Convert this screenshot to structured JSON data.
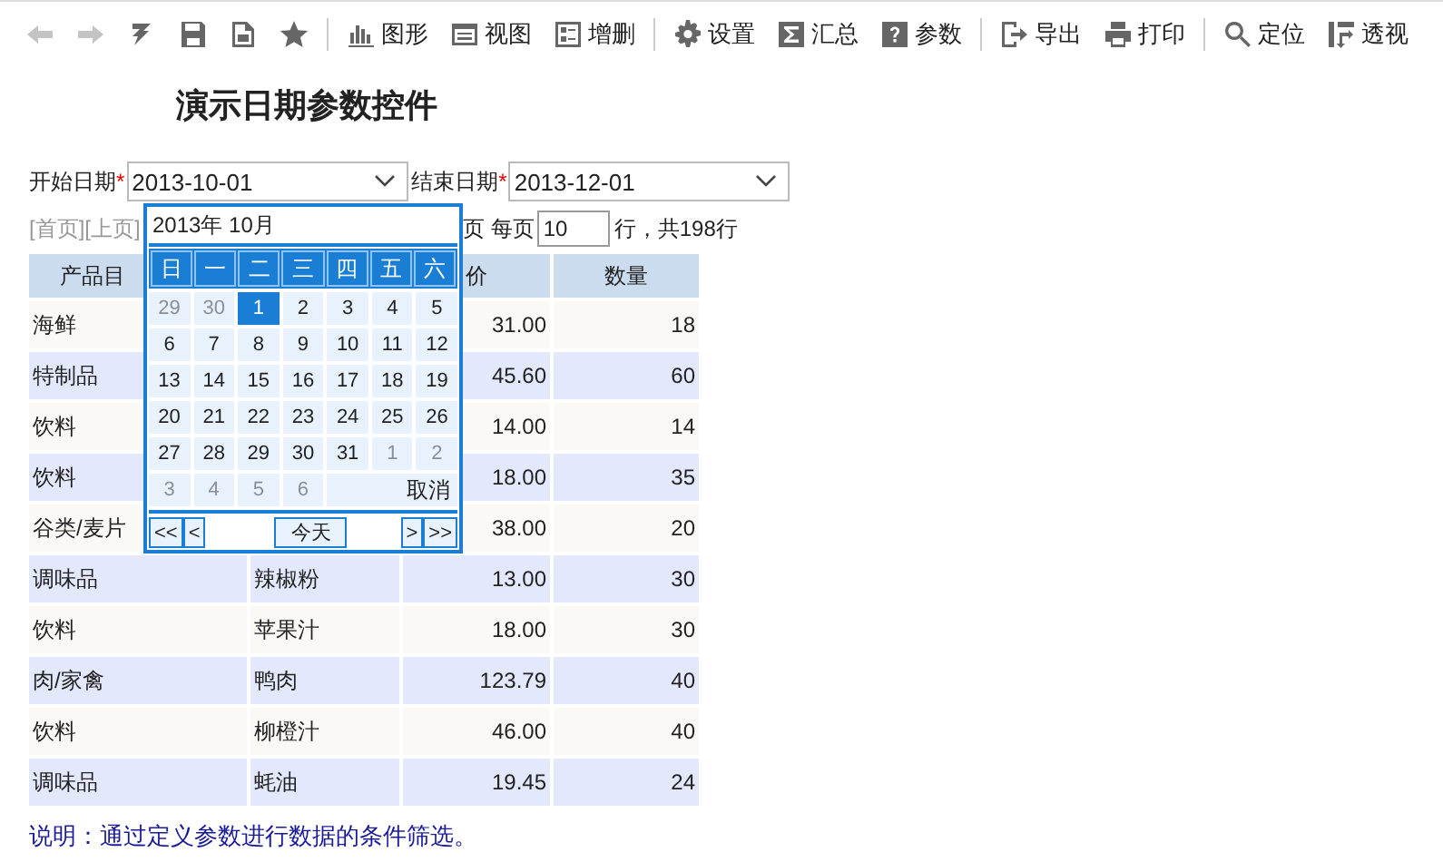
{
  "toolbar": {
    "groups": [
      [
        {
          "disabled": true
        },
        {
          "disabled": true
        },
        {
          "disabled": false
        },
        {
          "disabled": false
        },
        {
          "disabled": false
        },
        {
          "disabled": false
        }
      ],
      [
        {
          "label": "图形",
          "disabled": false
        },
        {
          "label": "视图",
          "disabled": false
        },
        {
          "label": "增删",
          "disabled": false
        }
      ],
      [
        {
          "label": "设置",
          "disabled": false
        },
        {
          "label": "汇总",
          "disabled": false
        },
        {
          "label": "参数",
          "disabled": false
        }
      ],
      [
        {
          "label": "导出",
          "disabled": false
        },
        {
          "label": "打印",
          "disabled": false
        }
      ],
      [
        {
          "label": "定位",
          "disabled": false
        },
        {
          "label": "透视",
          "disabled": false
        }
      ]
    ]
  },
  "title": "演示日期参数控件",
  "params": [
    {
      "label": "开始日期",
      "required_mark": "*",
      "value": "2013-10-01"
    },
    {
      "label": "结束日期",
      "required_mark": "*",
      "value": "2013-12-01"
    }
  ],
  "pagination": {
    "links": "[首页][上页]",
    "page_suffix": "页 每页",
    "per_page": "10",
    "total": "行，共198行"
  },
  "table": {
    "columns": [
      "产品目",
      "价",
      "数量"
    ],
    "rows": [
      {
        "category": "海鲜",
        "price": "31.00",
        "qty": "18"
      },
      {
        "category": "特制品",
        "price": "45.60",
        "qty": "60"
      },
      {
        "category": "饮料",
        "price": "14.00",
        "qty": "14"
      },
      {
        "category": "饮料",
        "price": "18.00",
        "qty": "35"
      },
      {
        "category": "谷类/麦片",
        "price": "38.00",
        "qty": "20"
      },
      {
        "category": "调味品",
        "product": "辣椒粉",
        "price": "13.00",
        "qty": "30"
      },
      {
        "category": "饮料",
        "product": "苹果汁",
        "price": "18.00",
        "qty": "30"
      },
      {
        "category": "肉/家禽",
        "product": "鸭肉",
        "price": "123.79",
        "qty": "40"
      },
      {
        "category": "饮料",
        "product": "柳橙汁",
        "price": "46.00",
        "qty": "40"
      },
      {
        "category": "调味品",
        "product": "蚝油",
        "price": "19.45",
        "qty": "24"
      }
    ]
  },
  "calendar": {
    "month": "2013年 10月",
    "weekdays": [
      "日",
      "一",
      "二",
      "三",
      "四",
      "五",
      "六"
    ],
    "days": [
      {
        "label": "29",
        "other_month": true,
        "selected": false
      },
      {
        "label": "30",
        "other_month": true,
        "selected": false
      },
      {
        "label": "1",
        "other_month": false,
        "selected": true
      },
      {
        "label": "2",
        "other_month": false,
        "selected": false
      },
      {
        "label": "3",
        "other_month": false,
        "selected": false
      },
      {
        "label": "4",
        "other_month": false,
        "selected": false
      },
      {
        "label": "5",
        "other_month": false,
        "selected": false
      },
      {
        "label": "6",
        "other_month": false,
        "selected": false
      },
      {
        "label": "7",
        "other_month": false,
        "selected": false
      },
      {
        "label": "8",
        "other_month": false,
        "selected": false
      },
      {
        "label": "9",
        "other_month": false,
        "selected": false
      },
      {
        "label": "10",
        "other_month": false,
        "selected": false
      },
      {
        "label": "11",
        "other_month": false,
        "selected": false
      },
      {
        "label": "12",
        "other_month": false,
        "selected": false
      },
      {
        "label": "13",
        "other_month": false,
        "selected": false
      },
      {
        "label": "14",
        "other_month": false,
        "selected": false
      },
      {
        "label": "15",
        "other_month": false,
        "selected": false
      },
      {
        "label": "16",
        "other_month": false,
        "selected": false
      },
      {
        "label": "17",
        "other_month": false,
        "selected": false
      },
      {
        "label": "18",
        "other_month": false,
        "selected": false
      },
      {
        "label": "19",
        "other_month": false,
        "selected": false
      },
      {
        "label": "20",
        "other_month": false,
        "selected": false
      },
      {
        "label": "21",
        "other_month": false,
        "selected": false
      },
      {
        "label": "22",
        "other_month": false,
        "selected": false
      },
      {
        "label": "23",
        "other_month": false,
        "selected": false
      },
      {
        "label": "24",
        "other_month": false,
        "selected": false
      },
      {
        "label": "25",
        "other_month": false,
        "selected": false
      },
      {
        "label": "26",
        "other_month": false,
        "selected": false
      },
      {
        "label": "27",
        "other_month": false,
        "selected": false
      },
      {
        "label": "28",
        "other_month": false,
        "selected": false
      },
      {
        "label": "29",
        "other_month": false,
        "selected": false
      },
      {
        "label": "30",
        "other_month": false,
        "selected": false
      },
      {
        "label": "31",
        "other_month": false,
        "selected": false
      },
      {
        "label": "1",
        "other_month": true,
        "selected": false
      },
      {
        "label": "2",
        "other_month": true,
        "selected": false
      },
      {
        "label": "3",
        "other_month": true,
        "selected": false
      },
      {
        "label": "4",
        "other_month": true,
        "selected": false
      },
      {
        "label": "5",
        "other_month": true,
        "selected": false
      },
      {
        "label": "6",
        "other_month": true,
        "selected": false
      }
    ],
    "cancel": "取消",
    "nav": {
      "prev_year": "<<",
      "prev_month": "<",
      "today": "今天",
      "next_month": ">",
      "next_year": ">>"
    }
  },
  "note": "说明：通过定义参数进行数据的条件筛选。"
}
